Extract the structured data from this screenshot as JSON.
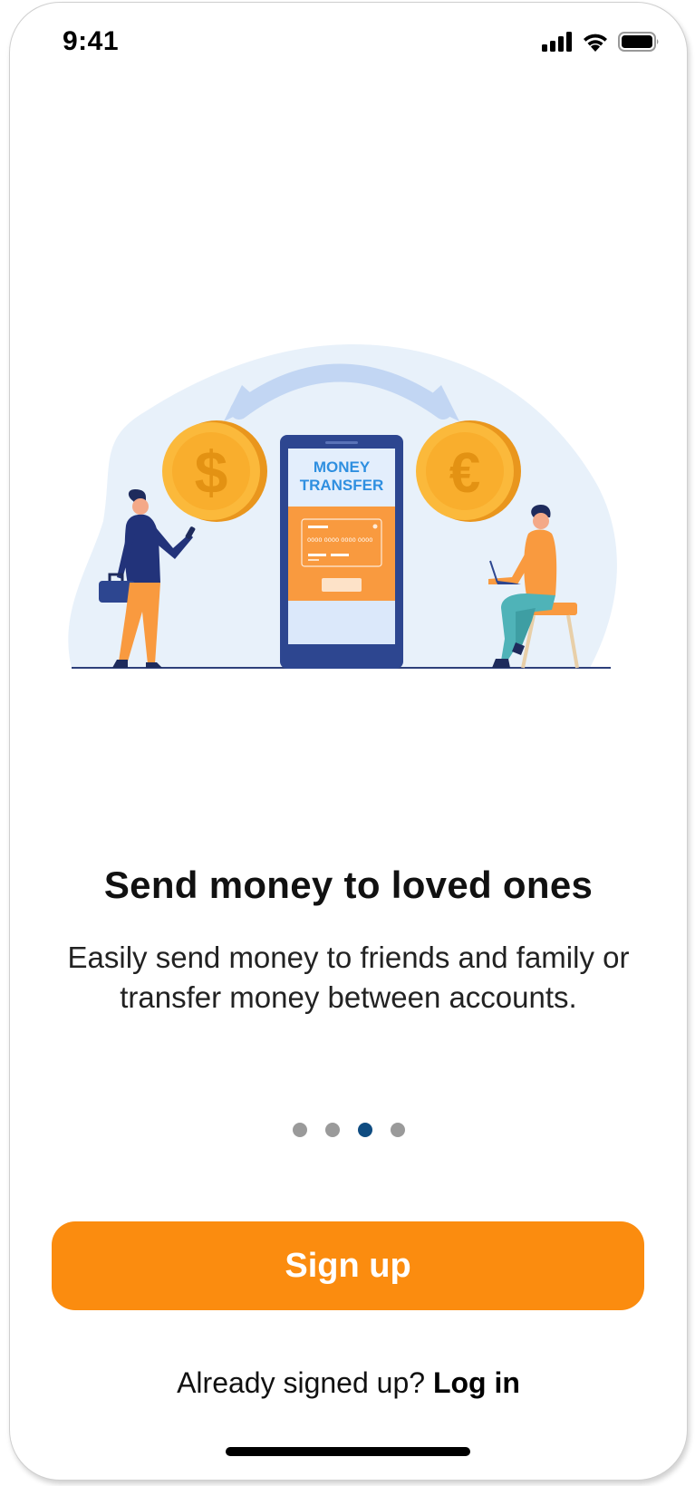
{
  "status_bar": {
    "time": "9:41",
    "icons": [
      "cellular-signal-icon",
      "wifi-icon",
      "battery-icon"
    ]
  },
  "illustration": {
    "phone_title_line1": "MONEY",
    "phone_title_line2": "TRANSFER",
    "card_number": "0000 0000 0000 0000",
    "left_coin_symbol": "$",
    "right_coin_symbol": "€"
  },
  "onboarding": {
    "headline": "Send money to loved ones",
    "description": "Easily send money to friends and family or transfer money between accounts.",
    "page_count": 4,
    "active_page": 3
  },
  "actions": {
    "signup_label": "Sign up",
    "login_prompt": "Already signed up?",
    "login_label": "Log in"
  },
  "colors": {
    "accent": "#fb8c0f",
    "active_dot": "#0f4c81",
    "inactive_dot": "#9a9a9a"
  }
}
